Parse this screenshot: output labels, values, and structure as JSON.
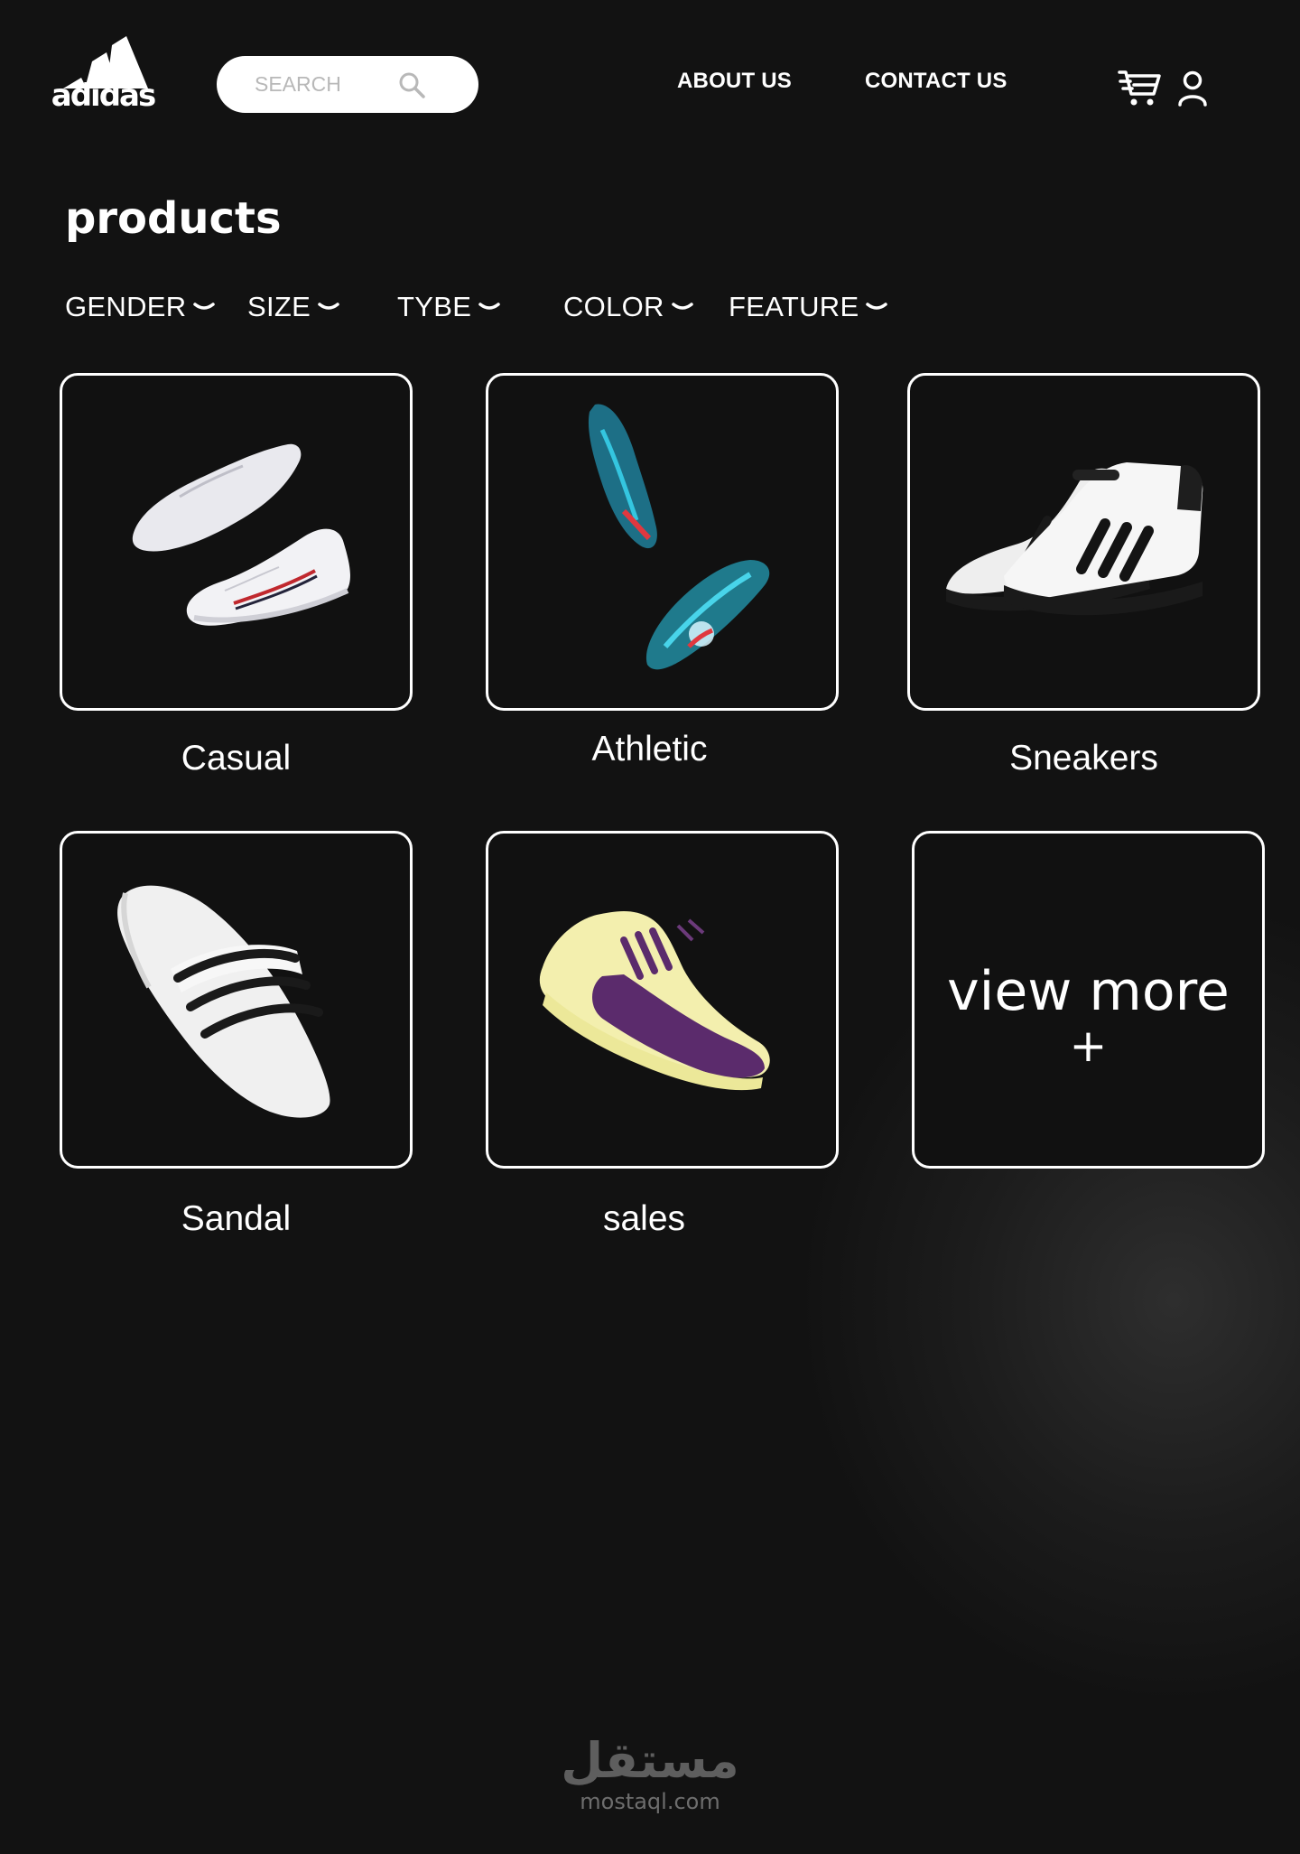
{
  "header": {
    "logo_text": "adidas",
    "search": {
      "placeholder": "SEARCH"
    },
    "nav": {
      "about": "ABOUT US",
      "contact": "CONTACT US"
    },
    "icons": [
      "search-icon",
      "cart-icon",
      "user-icon"
    ]
  },
  "page": {
    "title": "products"
  },
  "filters": [
    {
      "label": "GENDER"
    },
    {
      "label": "SIZE"
    },
    {
      "label": "TYBE"
    },
    {
      "label": "COLOR"
    },
    {
      "label": "FEATURE"
    }
  ],
  "products": [
    {
      "label": "Casual"
    },
    {
      "label": "Athletic"
    },
    {
      "label": "Sneakers"
    },
    {
      "label": "Sandal"
    },
    {
      "label": "sales"
    }
  ],
  "view_more": {
    "label": "view more",
    "icon": "+"
  },
  "watermark": {
    "arabic": "مستقل",
    "latin": "mostaql.com"
  },
  "colors": {
    "background": "#121212",
    "text": "#ffffff",
    "card_border": "#ffffff"
  }
}
